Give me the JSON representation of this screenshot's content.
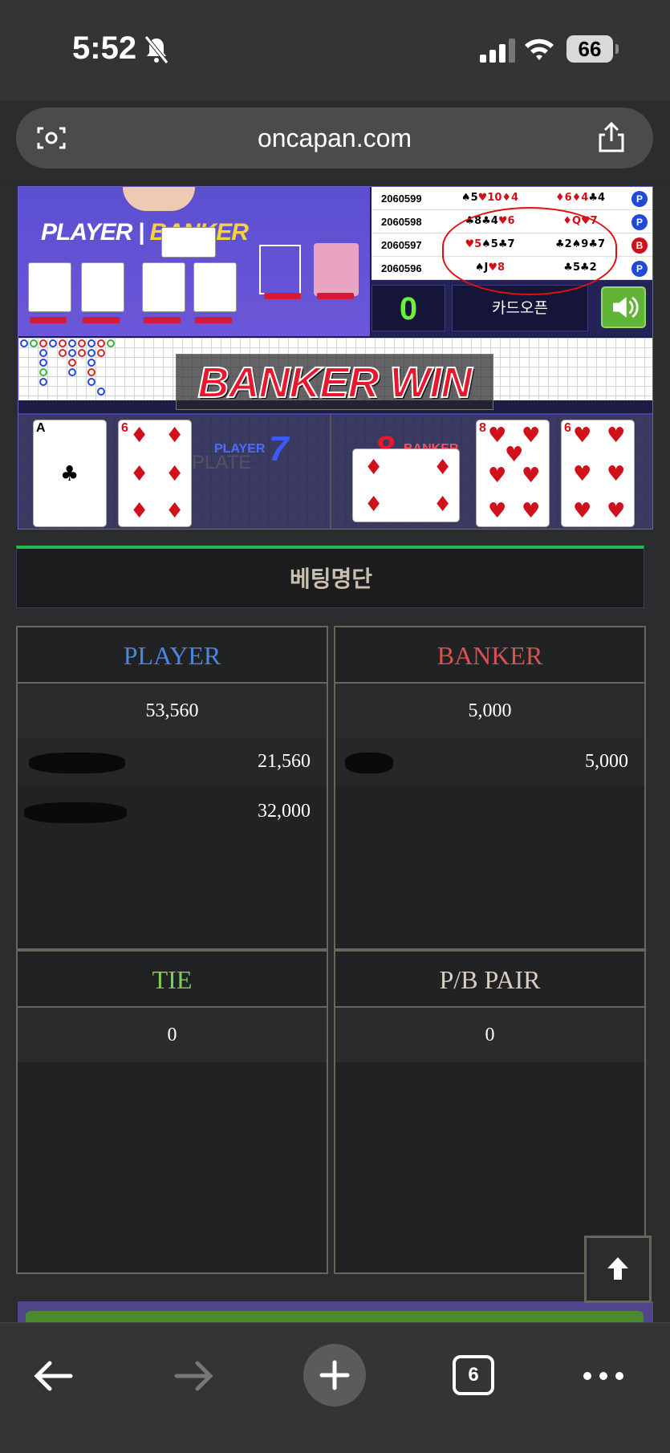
{
  "status_bar": {
    "time": "5:52",
    "battery": "66"
  },
  "browser": {
    "url": "oncapan.com",
    "tab_count": "6"
  },
  "game": {
    "live_title_player": "PLAYER",
    "live_title_banker": "BANKER",
    "history": [
      {
        "id": "2060599",
        "player": "♠5♥10♦4",
        "banker": "♦6♦4♣4",
        "result": "P"
      },
      {
        "id": "2060598",
        "player": "♣8♣4♥6",
        "banker": "♦Q♥7",
        "result": "P"
      },
      {
        "id": "2060597",
        "player": "♥5♠5♣7",
        "banker": "♣2♠9♣7",
        "result": "B"
      },
      {
        "id": "2060596",
        "player": "♠J♥8",
        "banker": "♣5♣2",
        "result": "P"
      }
    ],
    "counter": "0",
    "card_open_label": "카드오픈",
    "banner": "BANKER WIN",
    "player_label": "PLAYER",
    "player_score": "7",
    "banker_score": "8",
    "banker_label": "BANKER",
    "plate_text": "PLATE",
    "player_cards": [
      {
        "rank": "A",
        "suit": "♣"
      },
      {
        "rank": "6",
        "suit": "♦"
      }
    ],
    "banker_cards": [
      {
        "rank": "",
        "suit": "♦"
      },
      {
        "rank": "8",
        "suit": "♥"
      },
      {
        "rank": "6",
        "suit": "♥"
      }
    ],
    "colors": {
      "player": "#3c58ff",
      "banker": "#e8172d",
      "win_accent": "#27b84c"
    }
  },
  "betting": {
    "title": "베팅명단",
    "player": {
      "label": "PLAYER",
      "total": "53,560",
      "entries": [
        {
          "amount": "21,560"
        },
        {
          "amount": "32,000"
        }
      ]
    },
    "banker": {
      "label": "BANKER",
      "total": "5,000",
      "entries": [
        {
          "amount": "5,000"
        }
      ]
    },
    "tie": {
      "label": "TIE",
      "total": "0"
    },
    "pair": {
      "label": "P/B PAIR",
      "total": "0"
    }
  }
}
